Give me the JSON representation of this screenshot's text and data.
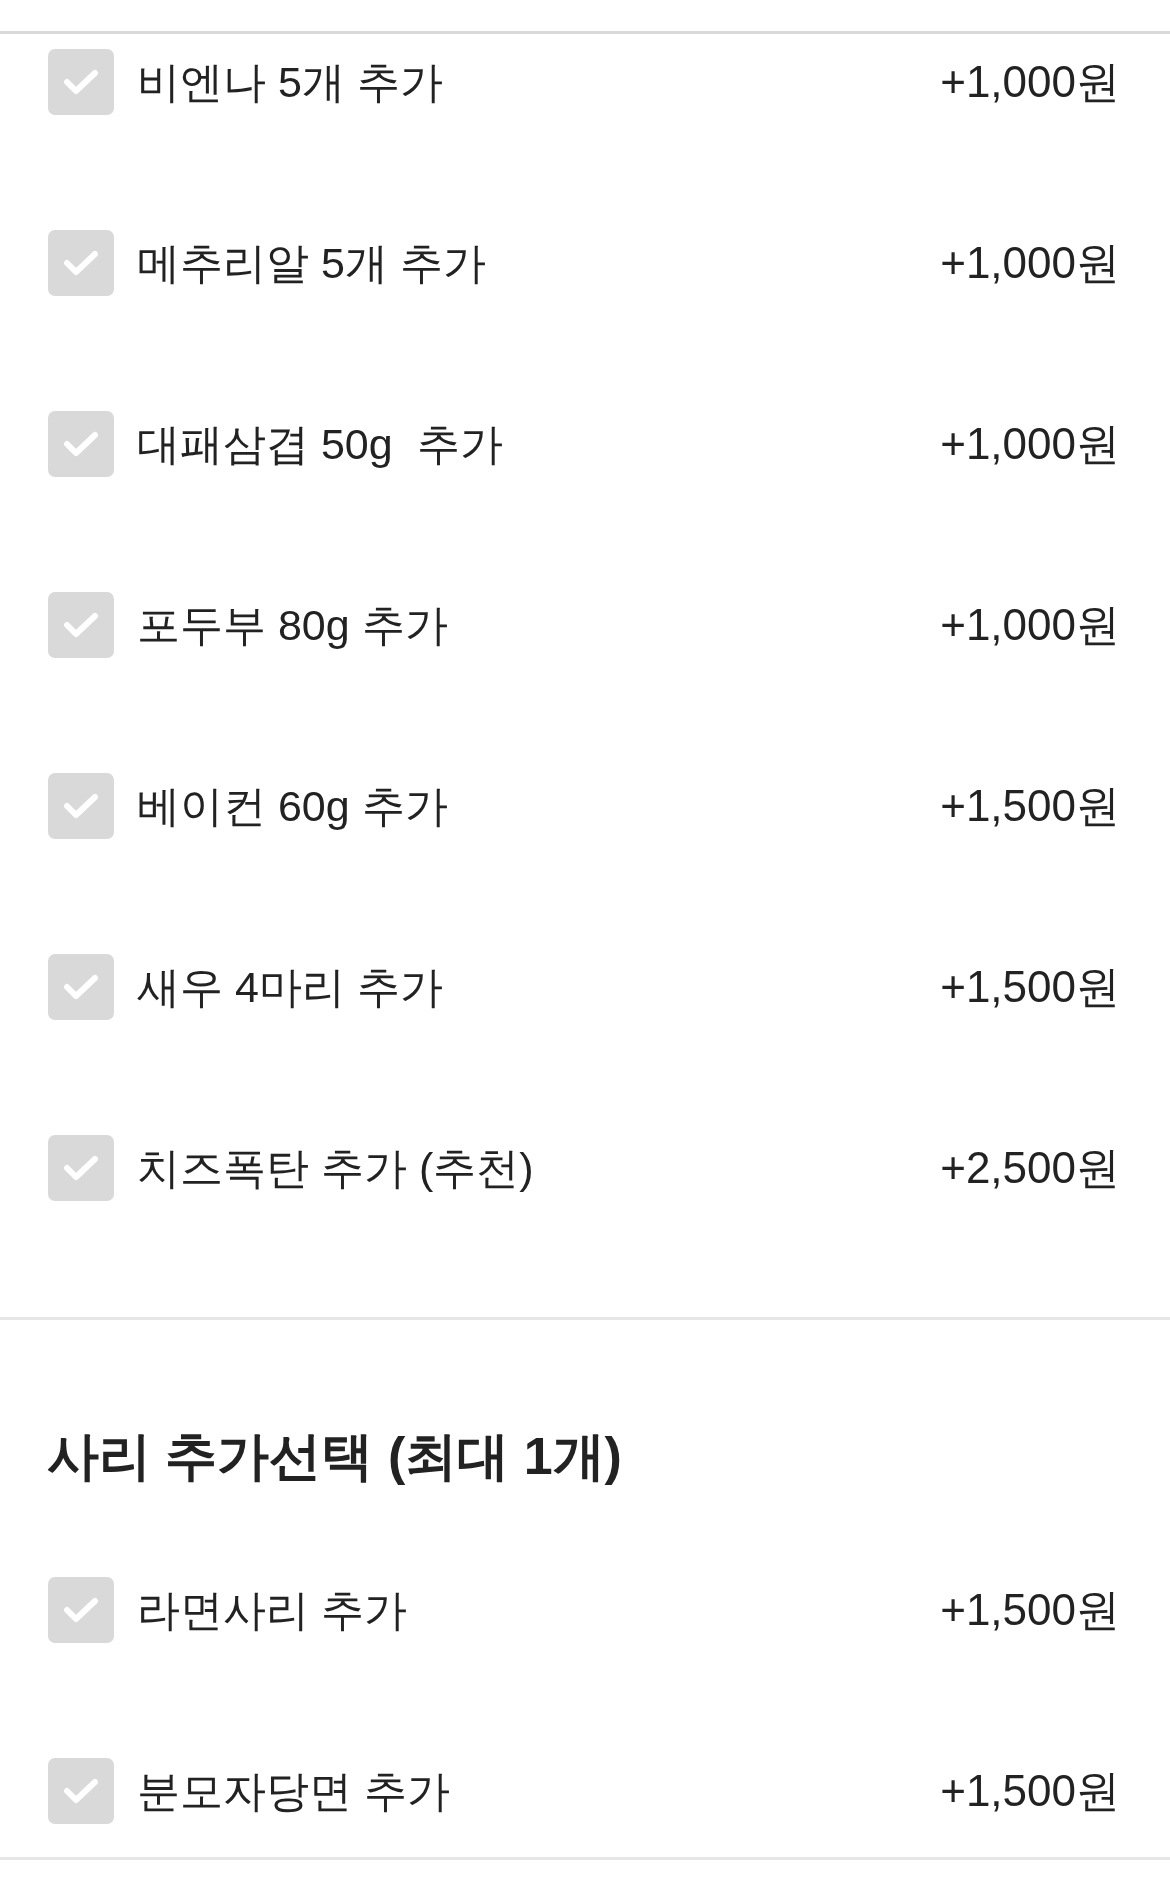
{
  "option_groups": [
    {
      "items": [
        {
          "label": "비엔나 5개 추가",
          "price": "+1,000원",
          "checked": false
        },
        {
          "label": "메추리알 5개 추가",
          "price": "+1,000원",
          "checked": false
        },
        {
          "label": "대패삼겹 50g  추가",
          "price": "+1,000원",
          "checked": false
        },
        {
          "label": "포두부 80g 추가",
          "price": "+1,000원",
          "checked": false
        },
        {
          "label": "베이컨 60g 추가",
          "price": "+1,500원",
          "checked": false
        },
        {
          "label": "새우 4마리 추가",
          "price": "+1,500원",
          "checked": false
        },
        {
          "label": "치즈폭탄 추가 (추천)",
          "price": "+2,500원",
          "checked": false
        }
      ]
    },
    {
      "title": "사리 추가선택 (최대 1개)",
      "items": [
        {
          "label": "라면사리 추가",
          "price": "+1,500원",
          "checked": false
        },
        {
          "label": "분모자당면 추가",
          "price": "+1,500원",
          "checked": false
        }
      ]
    }
  ]
}
